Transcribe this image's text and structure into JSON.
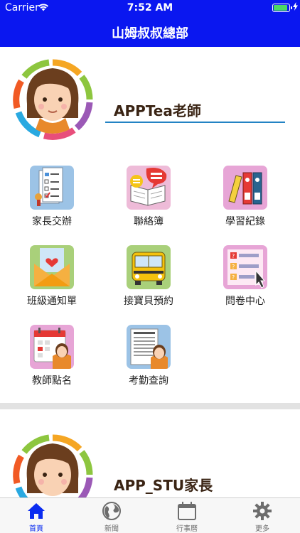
{
  "status_bar": {
    "carrier": "Carrier",
    "time": "7:52 AM",
    "battery_level": 1.0
  },
  "nav": {
    "title": "山姆叔叔總部"
  },
  "profiles": [
    {
      "name": "APPTea老師"
    },
    {
      "name": "APP_STU家長"
    }
  ],
  "menu": [
    {
      "label": "家長交辦",
      "icon": "checklist-icon"
    },
    {
      "label": "聯絡簿",
      "icon": "notebook-chat-icon"
    },
    {
      "label": "學習紀錄",
      "icon": "binders-icon"
    },
    {
      "label": "班級通知單",
      "icon": "envelope-heart-icon"
    },
    {
      "label": "接寶貝預約",
      "icon": "school-bus-icon"
    },
    {
      "label": "問卷中心",
      "icon": "survey-icon"
    },
    {
      "label": "教師點名",
      "icon": "calendar-teacher-icon"
    },
    {
      "label": "考勤查詢",
      "icon": "attendance-sheet-icon"
    }
  ],
  "tabs": [
    {
      "label": "首頁",
      "icon": "home-icon",
      "active": true
    },
    {
      "label": "新聞",
      "icon": "globe-icon",
      "active": false
    },
    {
      "label": "行事曆",
      "icon": "calendar-icon",
      "active": false
    },
    {
      "label": "更多",
      "icon": "gear-icon",
      "active": false
    }
  ],
  "colors": {
    "header": "#0a17f0",
    "accent_underline": "#2383c4",
    "active_tab": "#0a2cf0"
  }
}
